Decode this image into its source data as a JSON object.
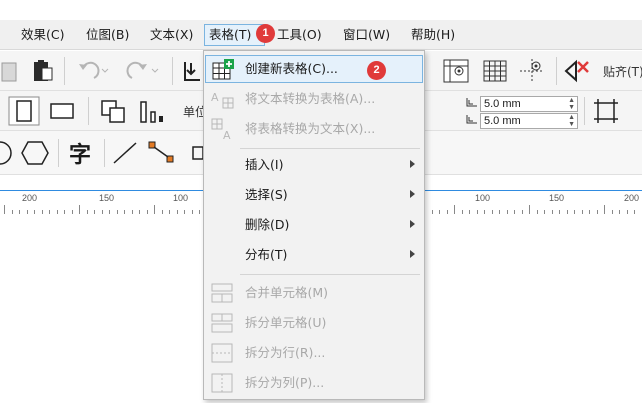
{
  "menubar": {
    "items": [
      {
        "label": "效果(C)"
      },
      {
        "label": "位图(B)"
      },
      {
        "label": "文本(X)"
      },
      {
        "label": "表格(T)"
      },
      {
        "label": "工具(O)"
      },
      {
        "label": "窗口(W)"
      },
      {
        "label": "帮助(H)"
      }
    ],
    "badge1": "1"
  },
  "toolbar1": {
    "snap_label": "贴齐(T)"
  },
  "toolbar2": {
    "unit_label": "单位",
    "dup_x": "5.0 mm",
    "dup_y": "5.0 mm"
  },
  "toolbar3": {
    "text_tool_glyph": "字"
  },
  "ruler": {
    "labels": [
      "200",
      "150",
      "100",
      "100",
      "150",
      "200"
    ]
  },
  "dropdown": {
    "badge2": "2",
    "items": [
      {
        "label": "创建新表格(C)...",
        "disabled": false,
        "submenu": false,
        "icon": "create-table-icon"
      },
      {
        "label": "将文本转换为表格(A)...",
        "disabled": true,
        "submenu": false,
        "icon": "text-to-table-icon"
      },
      {
        "label": "将表格转换为文本(X)...",
        "disabled": true,
        "submenu": false,
        "icon": "table-to-text-icon"
      },
      {
        "label": "插入(I)",
        "disabled": false,
        "submenu": true
      },
      {
        "label": "选择(S)",
        "disabled": false,
        "submenu": true
      },
      {
        "label": "删除(D)",
        "disabled": false,
        "submenu": true
      },
      {
        "label": "分布(T)",
        "disabled": false,
        "submenu": true
      },
      {
        "label": "合并单元格(M)",
        "disabled": true,
        "submenu": false,
        "icon": "merge-cells-icon"
      },
      {
        "label": "拆分单元格(U)",
        "disabled": true,
        "submenu": false,
        "icon": "split-cells-icon"
      },
      {
        "label": "拆分为行(R)...",
        "disabled": true,
        "submenu": false,
        "icon": "split-rows-icon"
      },
      {
        "label": "拆分为列(P)...",
        "disabled": true,
        "submenu": false,
        "icon": "split-columns-icon"
      }
    ]
  },
  "colors": {
    "accent": "#2f8be0",
    "badge": "#e03a3a",
    "highlight": "#e5f1fb",
    "create_table_green": "#1aa34a"
  }
}
